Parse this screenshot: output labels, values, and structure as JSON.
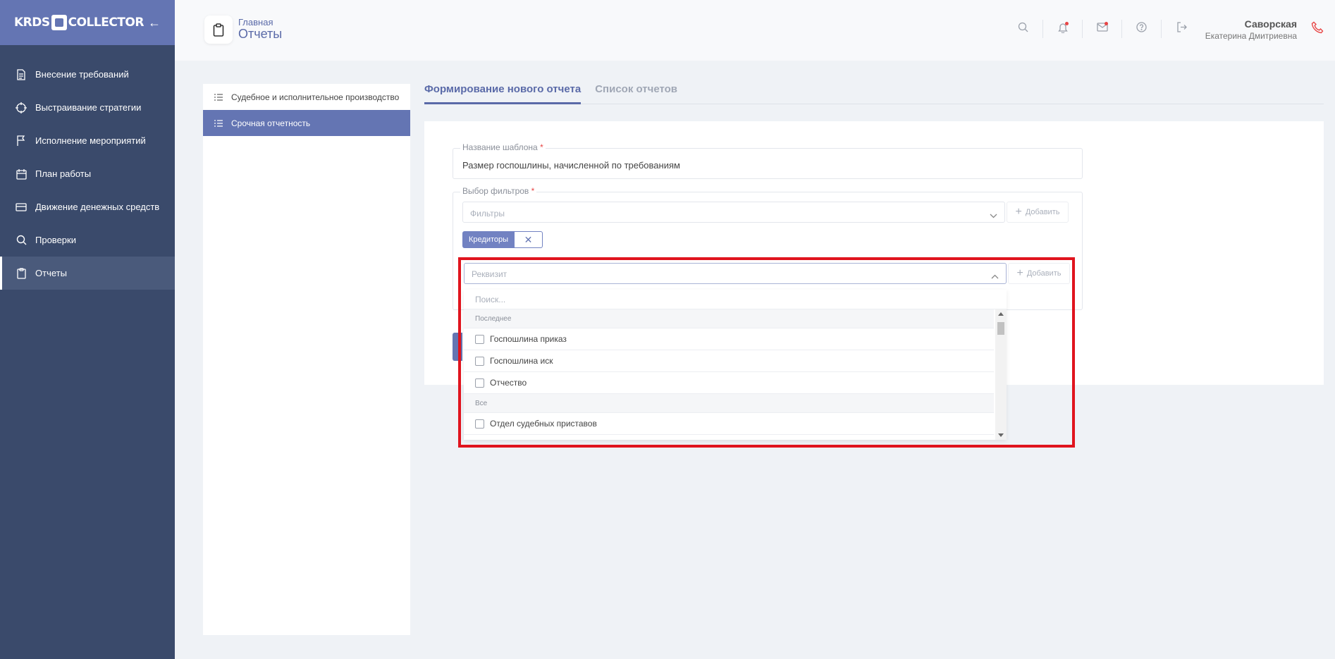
{
  "app": {
    "logo_left": "KRDS",
    "logo_right": "COLLECTOR"
  },
  "sidebar": {
    "items": [
      {
        "label": "Внесение требований",
        "icon": "document-icon"
      },
      {
        "label": "Выстраивание стратегии",
        "icon": "crosshair-icon"
      },
      {
        "label": "Исполнение мероприятий",
        "icon": "flag-icon"
      },
      {
        "label": "План работы",
        "icon": "calendar-icon"
      },
      {
        "label": "Движение денежных средств",
        "icon": "credit-card-icon"
      },
      {
        "label": "Проверки",
        "icon": "search-icon"
      },
      {
        "label": "Отчеты",
        "icon": "clipboard-icon",
        "active": true
      }
    ]
  },
  "header": {
    "breadcrumb": "Главная",
    "title": "Отчеты",
    "user_lastname": "Саворская",
    "user_name": "Екатерина Дмитриевна"
  },
  "reports_menu": {
    "items": [
      {
        "label": "Судебное и исполнительное производство"
      },
      {
        "label": "Срочная отчетность",
        "active": true
      }
    ]
  },
  "tabs": [
    {
      "label": "Формирование нового отчета",
      "active": true
    },
    {
      "label": "Список отчетов"
    }
  ],
  "form": {
    "template_name_label": "Название шаблона",
    "template_name_value": "Размер госпошлины, начисленной по требованиям",
    "filters_label": "Выбор фильтров",
    "required_mark": "*",
    "filters_placeholder": "Фильтры",
    "add_label": "Добавить",
    "chip_label": "Кредиторы",
    "requisite_placeholder": "Реквизит"
  },
  "dropdown": {
    "search_placeholder": "Поиск...",
    "recent_label": "Последнее",
    "recent_items": [
      "Госпошлина приказ",
      "Госпошлина иск",
      "Отчество"
    ],
    "all_label": "Все",
    "all_items": [
      "Отдел судебных приставов"
    ]
  },
  "colors": {
    "accent": "#6475b3",
    "sidebar": "#3a4a6b",
    "highlight": "#e0141e"
  }
}
